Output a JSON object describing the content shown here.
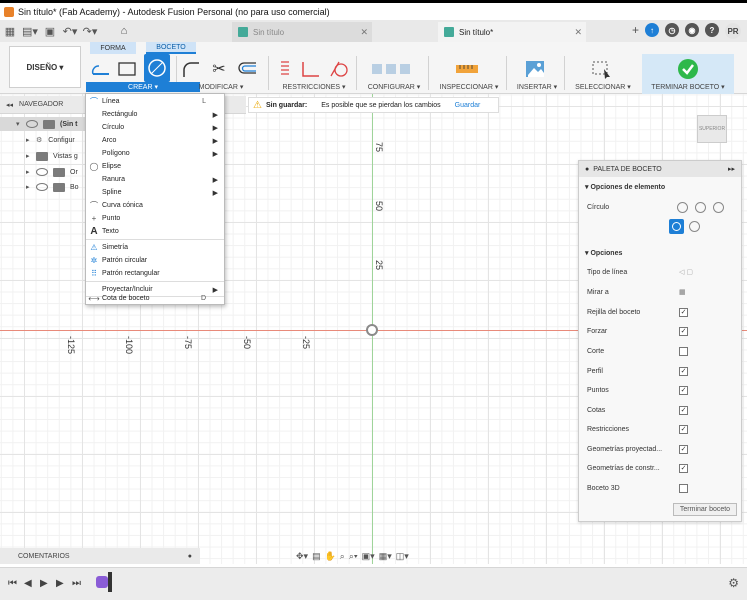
{
  "window": {
    "title": "Sin título* (Fab Academy) - Autodesk Fusion Personal (no para uso comercial)"
  },
  "tabs": [
    {
      "label": "Sin título"
    },
    {
      "label": "Sin título*"
    }
  ],
  "profile": {
    "initials": "PR"
  },
  "ribbon": {
    "workspace": "DISEÑO ▾",
    "tab_forma": "FORMA",
    "tab_boceto": "BOCETO",
    "groups": {
      "crear": "CREAR ▾",
      "modificar": "MODIFICAR ▾",
      "restricciones": "RESTRICCIONES ▾",
      "configurar": "CONFIGURAR ▾",
      "inspeccionar": "INSPECCIONAR ▾",
      "insertar": "INSERTAR ▾",
      "seleccionar": "SELECCIONAR ▾",
      "terminar": "TERMINAR BOCETO ▾"
    }
  },
  "navigator": {
    "title": "NAVEGADOR",
    "items": [
      {
        "label": "(Sin t"
      },
      {
        "label": "Configur"
      },
      {
        "label": "Vistas g"
      },
      {
        "label": "Or"
      },
      {
        "label": "Bo"
      }
    ]
  },
  "warning": {
    "title": "Sin guardar:",
    "message": "Es posible que se pierdan los cambios",
    "action": "Guardar"
  },
  "create_menu": {
    "items": [
      {
        "label": "Línea",
        "shortcut": "L"
      },
      {
        "label": "Rectángulo"
      },
      {
        "label": "Círculo"
      },
      {
        "label": "Arco"
      },
      {
        "label": "Polígono"
      },
      {
        "label": "Elipse"
      },
      {
        "label": "Ranura"
      },
      {
        "label": "Spline"
      },
      {
        "label": "Curva cónica"
      },
      {
        "label": "Punto"
      },
      {
        "label": "Texto"
      },
      {
        "label": "Simetría"
      },
      {
        "label": "Patrón circular"
      },
      {
        "label": "Patrón rectangular"
      },
      {
        "label": "Proyectar/Incluir"
      },
      {
        "label": "Cota de boceto",
        "shortcut": "D"
      }
    ]
  },
  "canvas": {
    "x_ticks": [
      "-125",
      "-100",
      "-75",
      "-50",
      "-25"
    ],
    "y_ticks": [
      "75",
      "50",
      "25"
    ],
    "viewcube_label": "SUPERIOR"
  },
  "palette": {
    "title": "PALETA DE BOCETO",
    "section_element": "Opciones de elemento",
    "circle_label": "Círculo",
    "section_options": "Opciones",
    "rows": [
      {
        "label": "Tipo de línea"
      },
      {
        "label": "Mirar a"
      },
      {
        "label": "Rejilla del boceto",
        "checked": true
      },
      {
        "label": "Forzar",
        "checked": true
      },
      {
        "label": "Corte",
        "checked": false
      },
      {
        "label": "Perfil",
        "checked": true
      },
      {
        "label": "Puntos",
        "checked": true
      },
      {
        "label": "Cotas",
        "checked": true
      },
      {
        "label": "Restricciones",
        "checked": true
      },
      {
        "label": "Geometrías proyectad...",
        "checked": true
      },
      {
        "label": "Geometrías de constr...",
        "checked": true
      },
      {
        "label": "Boceto 3D",
        "checked": false
      }
    ],
    "finish_button": "Terminar boceto"
  },
  "comments": {
    "title": "COMENTARIOS"
  },
  "colors": {
    "accent": "#1e7fd6",
    "x_axis": "#e88a7a",
    "y_axis": "#9fd49a",
    "finish_green": "#2eb84a"
  }
}
